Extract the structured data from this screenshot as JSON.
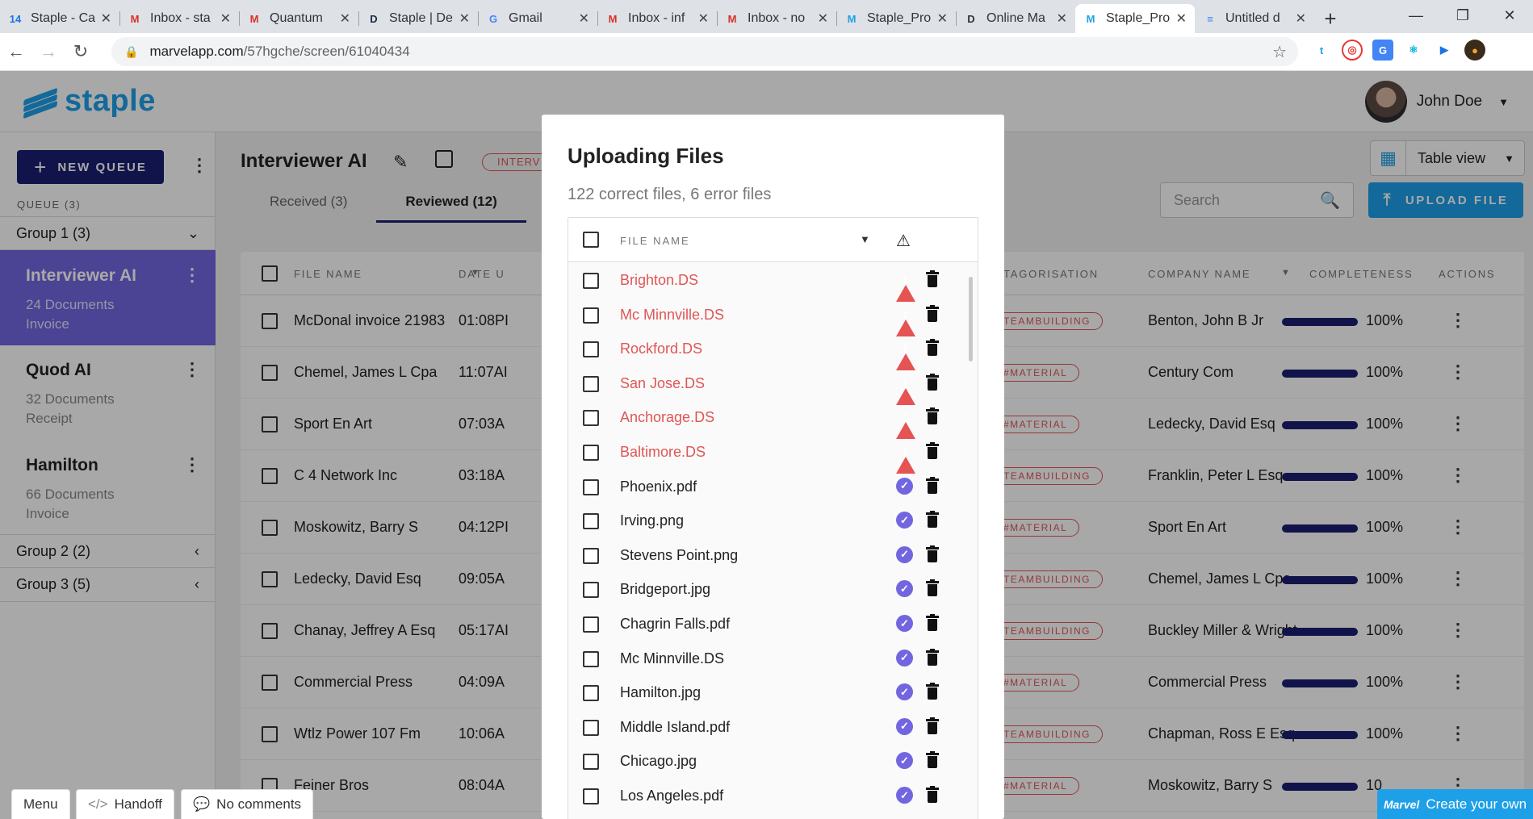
{
  "browser": {
    "tabs": [
      {
        "label": "Staple - Ca",
        "fav": "14",
        "color": "#1a73e8",
        "active": false
      },
      {
        "label": "Inbox - sta",
        "fav": "M",
        "color": "#d93025",
        "active": false
      },
      {
        "label": "Quantum",
        "fav": "M",
        "color": "#d93025",
        "active": false
      },
      {
        "label": "Staple | De",
        "fav": "D",
        "color": "#1c2a48",
        "active": false
      },
      {
        "label": "Gmail",
        "fav": "G",
        "color": "#4285f4",
        "active": false
      },
      {
        "label": "Inbox - inf",
        "fav": "M",
        "color": "#d93025",
        "active": false
      },
      {
        "label": "Inbox - no",
        "fav": "M",
        "color": "#d93025",
        "active": false
      },
      {
        "label": "Staple_Pro",
        "fav": "M",
        "color": "#1ea0e8",
        "active": false
      },
      {
        "label": "Online Ma",
        "fav": "D",
        "color": "#333333",
        "active": false
      },
      {
        "label": "Staple_Pro",
        "fav": "M",
        "color": "#1ea0e8",
        "active": true
      },
      {
        "label": "Untitled d",
        "fav": "≡",
        "color": "#4285f4",
        "active": false
      }
    ],
    "url_host": "marvelapp.com",
    "url_path": "/57hgche/screen/61040434"
  },
  "app": {
    "logo_text": "staple",
    "user_name": "John Doe",
    "new_queue_label": "NEW QUEUE",
    "queue_label": "QUEUE (3)",
    "groups": [
      {
        "label": "Group 1 (3)",
        "chevron": "⌄"
      },
      {
        "label": "Group 2 (2)",
        "chevron": "‹"
      },
      {
        "label": "Group 3 (5)",
        "chevron": "‹"
      }
    ],
    "queues": [
      {
        "name": "Interviewer AI",
        "count": "24 Documents",
        "type": "Invoice"
      },
      {
        "name": "Quod AI",
        "count": "32 Documents",
        "type": "Receipt"
      },
      {
        "name": "Hamilton",
        "count": "66 Documents",
        "type": "Invoice"
      }
    ],
    "queue_title": "Interviewer AI",
    "queue_badge": "INTERV",
    "subtabs": [
      "Received (3)",
      "Reviewed (12)"
    ],
    "view_label": "Table view",
    "search_placeholder": "Search",
    "upload_label": "UPLOAD FILE",
    "table_headers": {
      "file_name": "FILE NAME",
      "date": "DATE U",
      "categorisation": "TAGORISATION",
      "company": "COMPANY NAME",
      "completeness": "COMPLETENESS",
      "actions": "ACTIONS"
    },
    "rows": [
      {
        "file": "McDonal invoice 21983",
        "time": "01:08PI",
        "tag": "TEAMBUILDING",
        "company": "Benton, John B Jr",
        "pct": "100%"
      },
      {
        "file": "Chemel, James L Cpa",
        "time": "11:07AI",
        "tag": "#MATERIAL",
        "company": "Century Com",
        "pct": "100%"
      },
      {
        "file": "Sport En Art",
        "time": "07:03A",
        "tag": "#MATERIAL",
        "company": "Ledecky, David Esq",
        "pct": "100%"
      },
      {
        "file": "C 4 Network Inc",
        "time": "03:18A",
        "tag": "TEAMBUILDING",
        "company": "Franklin, Peter L Esq",
        "pct": "100%"
      },
      {
        "file": "Moskowitz, Barry S",
        "time": "04:12PI",
        "tag": "#MATERIAL",
        "company": "Sport En Art",
        "pct": "100%"
      },
      {
        "file": "Ledecky, David Esq",
        "time": "09:05A",
        "tag": "TEAMBUILDING",
        "company": "Chemel, James L Cpa",
        "pct": "100%"
      },
      {
        "file": "Chanay, Jeffrey A Esq",
        "time": "05:17AI",
        "tag": "TEAMBUILDING",
        "company": "Buckley Miller & Wright",
        "pct": "100%"
      },
      {
        "file": "Commercial Press",
        "time": "04:09A",
        "tag": "#MATERIAL",
        "company": "Commercial Press",
        "pct": "100%"
      },
      {
        "file": "Wtlz Power 107 Fm",
        "time": "10:06A",
        "tag": "TEAMBUILDING",
        "company": "Chapman, Ross E Esq",
        "pct": "100%"
      },
      {
        "file": "Feiner Bros",
        "time": "08:04A",
        "tag": "#MATERIAL",
        "company": "Moskowitz, Barry S",
        "pct": "10"
      }
    ]
  },
  "modal": {
    "title": "Uploading Files",
    "subtitle": "122 correct files, 6 error files",
    "header_label": "FILE NAME",
    "files": [
      {
        "name": "Brighton.DS",
        "error": true
      },
      {
        "name": "Mc Minnville.DS",
        "error": true
      },
      {
        "name": "Rockford.DS",
        "error": true
      },
      {
        "name": "San Jose.DS",
        "error": true
      },
      {
        "name": "Anchorage.DS",
        "error": true
      },
      {
        "name": "Baltimore.DS",
        "error": true
      },
      {
        "name": "Phoenix.pdf",
        "error": false
      },
      {
        "name": "Irving.png",
        "error": false
      },
      {
        "name": "Stevens Point.png",
        "error": false
      },
      {
        "name": "Bridgeport.jpg",
        "error": false
      },
      {
        "name": "Chagrin Falls.pdf",
        "error": false
      },
      {
        "name": "Mc Minnville.DS",
        "error": false
      },
      {
        "name": "Hamilton.jpg",
        "error": false
      },
      {
        "name": "Middle Island.pdf",
        "error": false
      },
      {
        "name": "Chicago.jpg",
        "error": false
      },
      {
        "name": "Los Angeles.pdf",
        "error": false
      }
    ]
  },
  "marvel": {
    "menu_label": "Menu",
    "handoff_label": "Handoff",
    "comments_label": "No comments",
    "create_label": "Create your own",
    "create_logo": "Marvel"
  }
}
